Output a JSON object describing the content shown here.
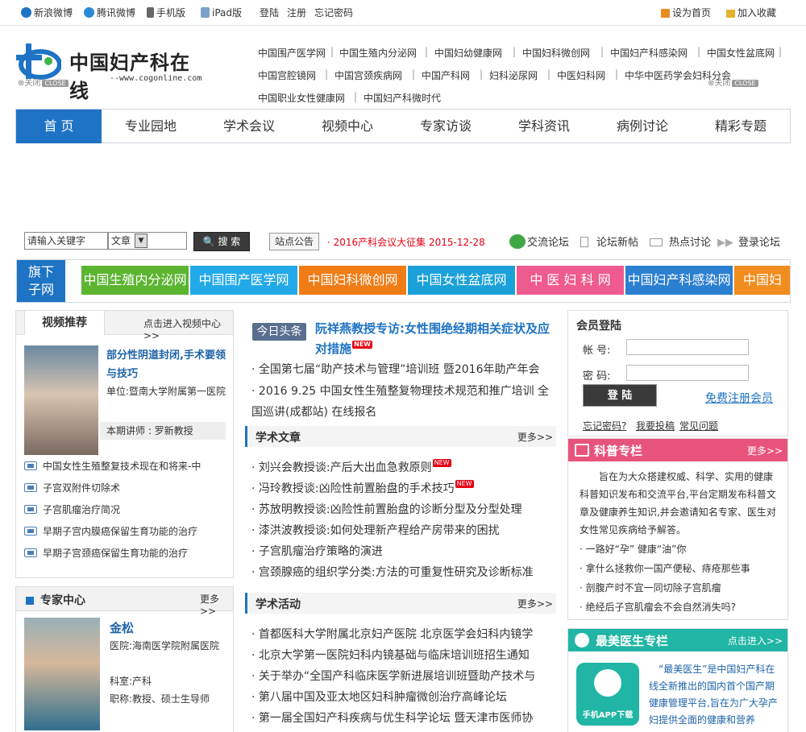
{
  "topbar": {
    "weibo_sina": "新浪微博",
    "weibo_tencent": "腾讯微博",
    "mobile": "手机版",
    "ipad": "iPad版",
    "login": "登陆",
    "register": "注册",
    "forgot": "忘记密码",
    "set_home": "设为首页",
    "add_fav": "加入收藏"
  },
  "logo": {
    "text": "中国妇产科在线",
    "url": "--www.cogonline.com"
  },
  "close": {
    "left": "关闭",
    "right": "关闭",
    "tag": "CLOSE"
  },
  "sites": [
    "中国围产医学网",
    "中国生殖内分泌网",
    "中国妇幼健康网",
    "中国妇科微创网",
    "中国妇产科感染网",
    "中国女性盆底网",
    "中国宫腔镜网",
    "中国宫颈疾病网",
    "中国产科网",
    "妇科泌尿网",
    "中医妇科网",
    "中华中医药学会妇科分会",
    "中国职业女性健康网",
    "中国妇产科微时代"
  ],
  "nav": [
    "首 页",
    "专业园地",
    "学术会议",
    "视频中心",
    "专家访谈",
    "学科资讯",
    "病例讨论",
    "精彩专题"
  ],
  "search": {
    "placeholder": "请输入关键字",
    "select": "文章",
    "button": "搜 索",
    "notice_tag": "站点公告",
    "notice": "2016产科会议大征集 2015-12-28",
    "forum": "交流论坛",
    "forum_new": "论坛新帖",
    "hot": "热点讨论",
    "login_forum": "登录论坛"
  },
  "subsites": {
    "title1": "旗下",
    "title2": "子网",
    "items": [
      "中国生殖内分泌网",
      "中国围产医学网",
      "中国妇科微创网",
      "中国女性盆底网",
      "中 医 妇 科 网",
      "中国妇产科感染网",
      "中国妇"
    ]
  },
  "video": {
    "title": "视频推荐",
    "more": "点击进入视频中心",
    "headline": "部分性阴道封闭,手术要领与技巧",
    "unit": "单位:暨南大学附属第一医院",
    "lecturer": "本期讲师 : 罗新教授",
    "items": [
      "中国女性生殖整复技术现在和将来-中",
      "子宫双附件切除术",
      "子宫肌瘤治疗简况",
      "早期子宫内膜癌保留生育功能的治疗",
      "早期子宫颈癌保留生育功能的治疗"
    ]
  },
  "expert": {
    "title": "专家中心",
    "more": "更多",
    "name": "金松",
    "hospital": "医院:海南医学院附属医院",
    "dept": "科室:产科",
    "title2": "职称:教授、硕士生导师"
  },
  "headline": {
    "tag": "今日头条",
    "title": "阮祥燕教授专访:女性围绝经期相关症状及应对措施",
    "new": "NEW",
    "items": [
      "全国第七届“助产技术与管理”培训班 暨2016年助产年会",
      "2016 9.25 中国女性生殖整复物理技术规范和推广培训 全国巡讲(成都站) 在线报名"
    ]
  },
  "articles": {
    "title": "学术文章",
    "more": "更多",
    "items": [
      "刘兴会教授谈:产后大出血急救原则",
      "冯玲教授谈:凶险性前置胎盘的手术技巧",
      "苏放明教授谈:凶险性前置胎盘的诊断分型及分型处理",
      "漆洪波教授谈:如何处理新产程给产房带来的困扰",
      "子宫肌瘤治疗策略的演进",
      "宫颈腺癌的组织学分类:方法的可重复性研究及诊断标准"
    ]
  },
  "activities": {
    "title": "学术活动",
    "more": "更多",
    "items": [
      "首都医科大学附属北京妇产医院 北京医学会妇科内镜学",
      "北京大学第一医院妇科内镜基础与临床培训班招生通知",
      "关于举办“全国产科临床医学新进展培训班暨助产技术与",
      "第八届中国及亚太地区妇科肿瘤微创治疗高峰论坛",
      "第一届全国妇产科疾病与优生科学论坛 暨天津市医师协"
    ]
  },
  "member": {
    "title": "会员登陆",
    "account": "帐 号:",
    "password": "密 码:",
    "login": "登 陆",
    "register": "免费注册会员",
    "forgot": "忘记密码?",
    "post": "我要投稿",
    "faq": "常见问题"
  },
  "science": {
    "title": "科普专栏",
    "more": "更多",
    "desc": "旨在为大众搭建权威、科学、实用的健康科普知识发布和交流平台,平台定期发布科普文章及健康养生知识,并会邀请知名专家、医生对女性常见疾病给予解答。",
    "items": [
      "一路好“孕” 健康“油”你",
      "拿什么拯救你一国产便秘、痔疮那些事",
      "剖腹产时不宜一同切除子宫肌瘤",
      "绝经后子宫肌瘤会不会自然消失吗?"
    ]
  },
  "doctor": {
    "title": "最美医生专栏",
    "more": "点击进入",
    "app": "手机APP下载",
    "desc": "“最美医生”是中国妇产科在线全新推出的国内首个国产期健康管理平台,旨在为广大孕产妇提供全面的健康和营养"
  },
  "colors": {
    "primary": "#1e73c4",
    "sub": [
      "#5cb531",
      "#22a9e8",
      "#f07c16",
      "#1aa1d9",
      "#ef5b8e",
      "#2b7fd0",
      "#f18c1e"
    ],
    "science": "#e8537c",
    "doctor": "#20b5a4"
  }
}
